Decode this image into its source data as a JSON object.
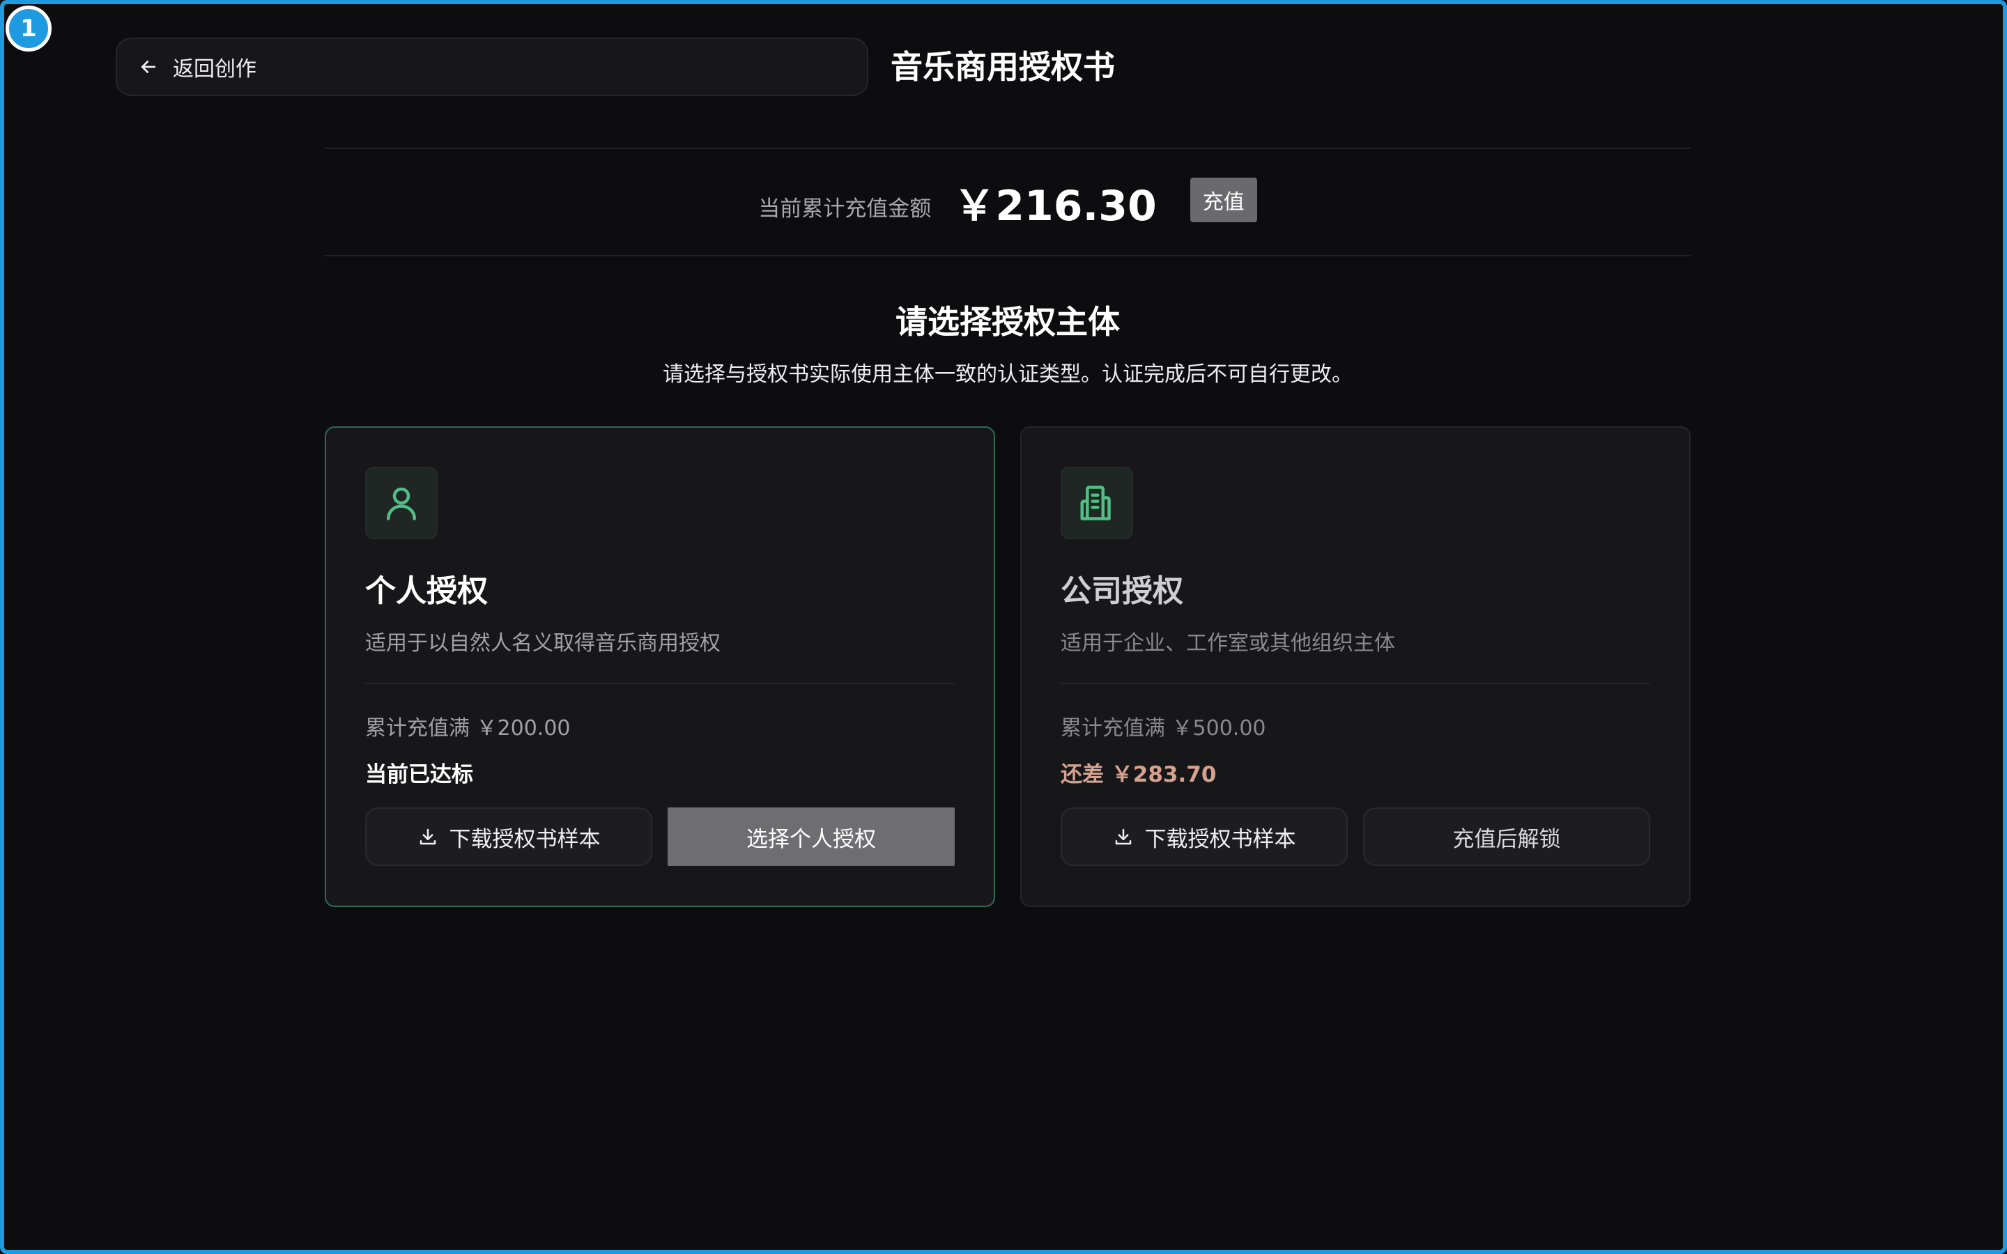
{
  "window": {
    "badge": "1"
  },
  "header": {
    "back_label": "返回创作",
    "title": "音乐商用授权书"
  },
  "balance": {
    "label": "当前累计充值金额",
    "amount": "￥216.30",
    "recharge_label": "充值"
  },
  "section": {
    "title": "请选择授权主体",
    "subtitle": "请选择与授权书实际使用主体一致的认证类型。认证完成后不可自行更改。"
  },
  "cards": [
    {
      "title": "个人授权",
      "description": "适用于以自然人名义取得音乐商用授权",
      "threshold": "累计充值满 ￥200.00",
      "status": "当前已达标",
      "download_label": "下载授权书样本",
      "action_label": "选择个人授权",
      "icon": "user-icon"
    },
    {
      "title": "公司授权",
      "description": "适用于企业、工作室或其他组织主体",
      "threshold": "累计充值满 ￥500.00",
      "status": "还差 ￥283.70",
      "download_label": "下载授权书样本",
      "action_label": "充值后解锁",
      "icon": "building-icon"
    }
  ],
  "colors": {
    "accent_green": "#4fbf85",
    "frame_blue": "#1e9be0",
    "warning_text": "#d6a28f",
    "background": "#0d0d0f"
  }
}
